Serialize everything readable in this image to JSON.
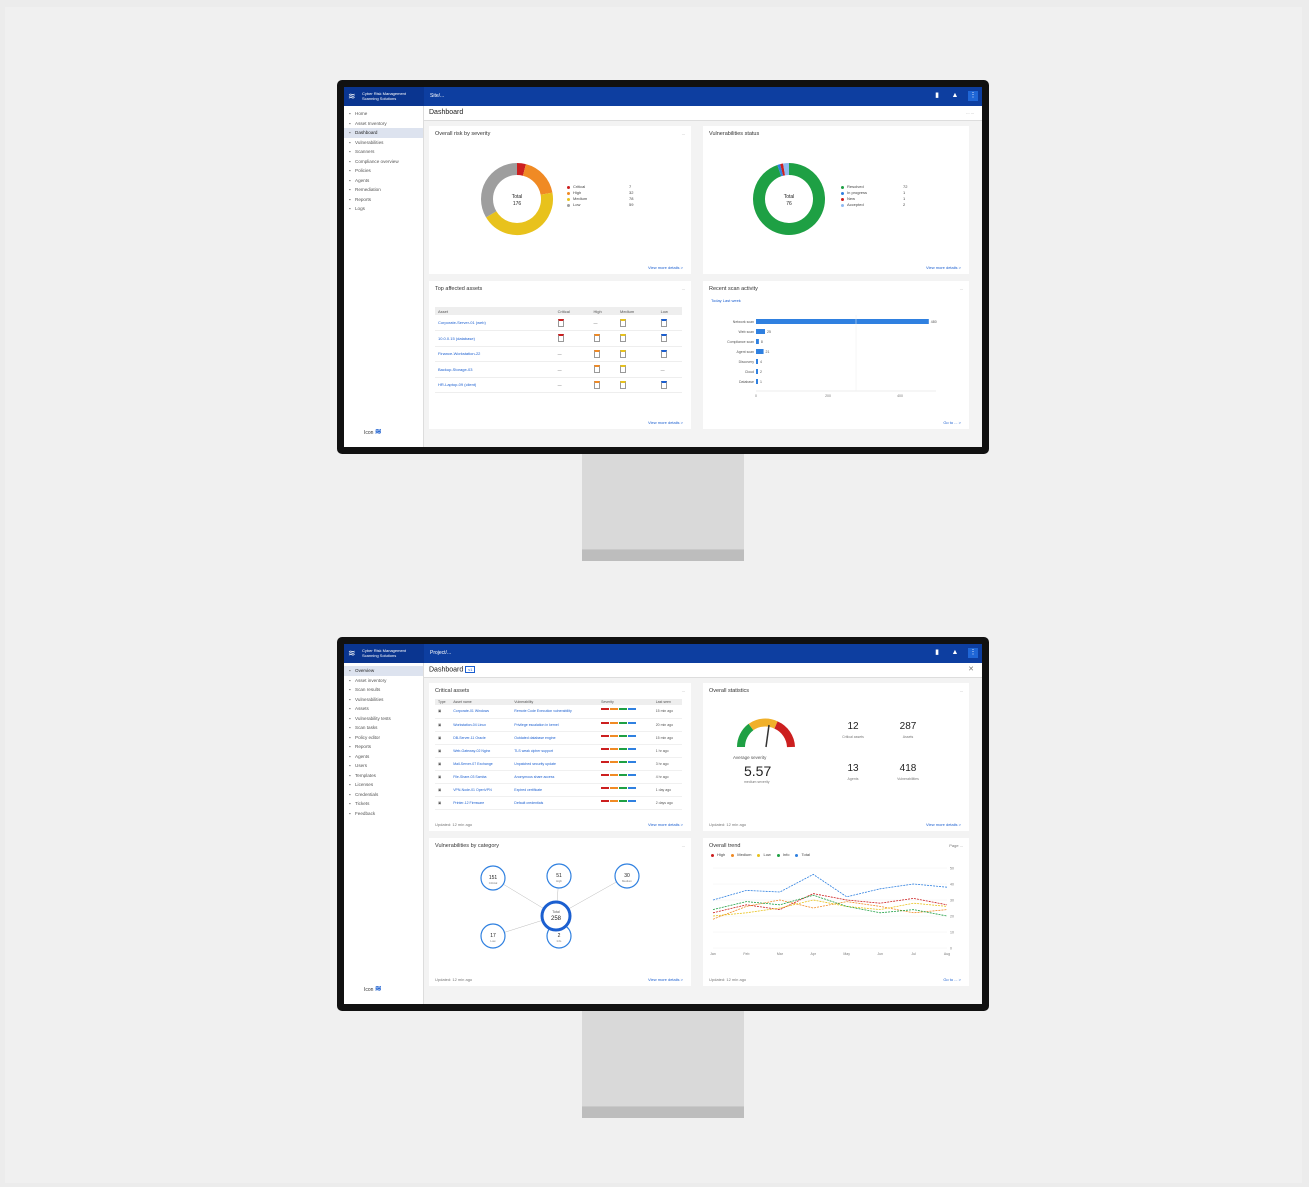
{
  "colors": {
    "brand": "#0d3ea0",
    "link": "#1b5fd0",
    "critical": "#cc1f1f",
    "high": "#f08a24",
    "medium": "#e8c21c",
    "low": "#9e9e9e",
    "good": "#1ea044"
  },
  "app": {
    "brand_line1": "Cyber Risk Management",
    "brand_line2": "Scanning Solutions",
    "logo_label": "wi-fi-icon"
  },
  "screen1": {
    "crumb": "Site/...",
    "title": "Dashboard",
    "title_right": "... ...",
    "sidebar": [
      "Home",
      "Asset Inventory",
      "Dashboard",
      "Vulnerabilities",
      "Scanners",
      "Compliance overview",
      "Policies",
      "Agents",
      "Remediation",
      "Reports",
      "Logs"
    ],
    "active_index": 2,
    "footer_logo": "Icon",
    "cards": {
      "donut1": {
        "title": "Overall risk by severity",
        "right": "...",
        "total_label": "Total",
        "total": "176",
        "legend": [
          {
            "name": "Critical",
            "value": "7"
          },
          {
            "name": "High",
            "value": "32"
          },
          {
            "name": "Medium",
            "value": "78"
          },
          {
            "name": "Low",
            "value": "59"
          }
        ],
        "link": "View more details >"
      },
      "donut2": {
        "title": "Vulnerabilities status",
        "total_label": "Total",
        "total": "76",
        "legend": [
          {
            "name": "Resolved",
            "value": "72"
          },
          {
            "name": "In progress",
            "value": "1"
          },
          {
            "name": "New",
            "value": "1"
          },
          {
            "name": "Accepted",
            "value": "2"
          }
        ],
        "link": "View more details >"
      },
      "issues": {
        "title": "Top affected assets",
        "right": "...",
        "headers": [
          "Asset",
          "Critical",
          "High",
          "Medium",
          "Low"
        ],
        "rows": [
          {
            "name": "Corporate-Server-01 (web)",
            "c": "7",
            "h": "",
            "m": "11",
            "l": "9"
          },
          {
            "name": "10.0.0.15 (database)",
            "c": "5",
            "h": "3",
            "m": "17",
            "l": "4"
          },
          {
            "name": "Finance-Workstation-22",
            "c": "",
            "h": "2",
            "m": "8",
            "l": "6"
          },
          {
            "name": "Backup-Storage-03",
            "c": "",
            "h": "4",
            "m": "5",
            "l": ""
          },
          {
            "name": "HR-Laptop-09 (client)",
            "c": "",
            "h": "1",
            "m": "3",
            "l": "7"
          }
        ],
        "link": "View more details >"
      },
      "scan": {
        "title": "Recent scan activity",
        "right": "...",
        "filter": "Today  Last week",
        "bars": [
          {
            "label": "Network scan",
            "value": 480,
            "text": "480"
          },
          {
            "label": "Web scan",
            "value": 25,
            "text": "25"
          },
          {
            "label": "Compliance scan",
            "value": 8,
            "text": "8"
          },
          {
            "label": "Agent scan",
            "value": 21,
            "text": "21"
          },
          {
            "label": "Discovery",
            "value": 4,
            "text": "4"
          },
          {
            "label": "Cloud",
            "value": 2,
            "text": "2"
          },
          {
            "label": "Database",
            "value": 1,
            "text": "1"
          }
        ],
        "axis": [
          "0",
          "200",
          "400"
        ],
        "link": "Go to ... >"
      }
    }
  },
  "screen2": {
    "crumb": "Project/...",
    "title": "Dashboard",
    "title_badge": "v1",
    "sidebar": [
      "Overview",
      "Asset inventory",
      "Scan results",
      "Vulnerabilities",
      "Assets",
      "Vulnerability tests",
      "Scan tasks",
      "Policy editor",
      "Reports",
      "Agents",
      "Users",
      "Templates",
      "Licenses",
      "Credentials",
      "Tickets",
      "Feedback"
    ],
    "active_index": 0,
    "footer_logo": "Icon",
    "cards": {
      "outdated": {
        "title": "Critical assets",
        "right": "...",
        "headers": [
          "Type",
          "Asset name",
          "Vulnerability",
          "Severity",
          "Last seen"
        ],
        "rows": [
          {
            "name": "Corporate-01 Windows",
            "vuln": "Remote Code Execution vulnerability",
            "last": "15 min ago"
          },
          {
            "name": "Workstation-04 Linux",
            "vuln": "Privilege escalation in kernel",
            "last": "20 min ago"
          },
          {
            "name": "DB-Server-11 Oracle",
            "vuln": "Outdated database engine",
            "last": "15 min ago"
          },
          {
            "name": "Web-Gateway-02 Nginx",
            "vuln": "TLS weak cipher support",
            "last": "1 hr ago"
          },
          {
            "name": "Mail-Server-07 Exchange",
            "vuln": "Unpatched security update",
            "last": "3 hr ago"
          },
          {
            "name": "File-Share-03 Samba",
            "vuln": "Anonymous share access",
            "last": "4 hr ago"
          },
          {
            "name": "VPN-Node-01 OpenVPN",
            "vuln": "Expired certificate",
            "last": "1 day ago"
          },
          {
            "name": "Printer-12 Firmware",
            "vuln": "Default credentials",
            "last": "2 days ago"
          }
        ],
        "footer": "Updated: 12 min ago",
        "link": "View more details >"
      },
      "stats": {
        "title": "Overall statistics",
        "right": "...",
        "gauge_label": "Average severity",
        "gauge_value": "5.57",
        "gauge_sub": "medium severity",
        "kpis": [
          {
            "value": "12",
            "label": "Critical assets"
          },
          {
            "value": "287",
            "label": "Assets"
          },
          {
            "value": "13",
            "label": "Agents"
          },
          {
            "value": "418",
            "label": "Vulnerabilities"
          }
        ],
        "footer": "Updated: 12 min ago",
        "link": "View more details >"
      },
      "network": {
        "title": "Vulnerabilities by category",
        "right": "...",
        "center_label": "Total",
        "center_value": "258",
        "nodes": [
          {
            "value": "151",
            "label": "Critical"
          },
          {
            "value": "51",
            "label": "High"
          },
          {
            "value": "30",
            "label": "Medium"
          },
          {
            "value": "17",
            "label": "Low"
          },
          {
            "value": "2",
            "label": "Info"
          }
        ],
        "footer": "Updated: 12 min ago",
        "link": "View more details >"
      },
      "trend": {
        "title": "Overall trend",
        "right": "Page ...",
        "footer": "Updated: 12 min ago",
        "link": "Go to ... >"
      }
    }
  },
  "chart_data": {
    "type": "line",
    "categories": [
      "Jan",
      "Feb",
      "Mar",
      "Apr",
      "May",
      "Jun",
      "Jul",
      "Aug"
    ],
    "series": [
      {
        "name": "High",
        "color": "#cc1f1f",
        "values": [
          22,
          27,
          24,
          34,
          30,
          28,
          31,
          27
        ]
      },
      {
        "name": "Medium",
        "color": "#f08a24",
        "values": [
          18,
          26,
          30,
          25,
          29,
          26,
          22,
          24
        ]
      },
      {
        "name": "Low",
        "color": "#e8c21c",
        "values": [
          20,
          22,
          25,
          30,
          26,
          24,
          28,
          26
        ]
      },
      {
        "name": "Info",
        "color": "#1ea044",
        "values": [
          24,
          29,
          27,
          33,
          26,
          22,
          24,
          20
        ]
      },
      {
        "name": "Total",
        "color": "#2f80e0",
        "values": [
          30,
          36,
          35,
          46,
          32,
          37,
          40,
          38
        ]
      }
    ],
    "ylim": [
      0,
      50
    ],
    "xlabel": "",
    "ylabel": ""
  }
}
